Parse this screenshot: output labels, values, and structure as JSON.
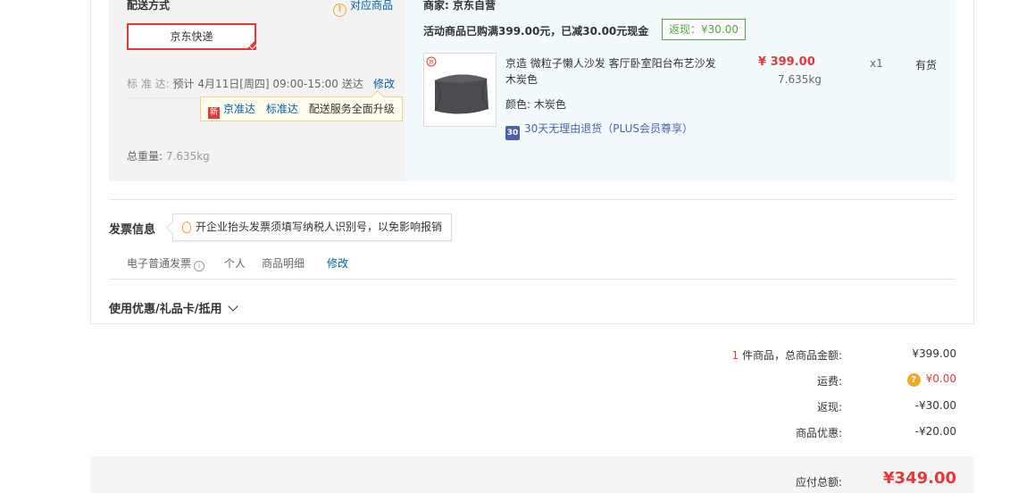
{
  "shipping": {
    "section_title": "配送方式",
    "matching_products_link": "对应商品",
    "method_label": "京东快递",
    "standard_label": "标  准  达:",
    "estimate_text": "预计 4月11日[周四] 09:00-15:00 送达",
    "modify_link": "修改",
    "tip_new_badge": "新",
    "tip_brand": "京准达",
    "tip_standard": "标准达",
    "tip_text": "配送服务全面升级",
    "total_weight_label": "总重量:",
    "total_weight_value": "7.635kg"
  },
  "goods": {
    "merchant_label": "商家:",
    "merchant_name": "京东自营",
    "promo_text": "活动商品已购满399.00元，已减30.00元现金",
    "rebate_tag": "返现：¥30.00",
    "product": {
      "name_line1": "京造 微粒子懒人沙发 客厅卧室阳台布艺沙发",
      "name_line2": "木炭色",
      "color_label": "颜色:",
      "color_value": "木炭色",
      "price": "¥ 399.00",
      "weight": "7.635kg",
      "quantity": "x1",
      "stock": "有货",
      "return_badge": "30",
      "return_text": "30天无理由退货（PLUS会员尊享）"
    }
  },
  "invoice": {
    "section_title": "发票信息",
    "tip_text": "开企业抬头发票须填写纳税人识别号，以免影响报销",
    "type": "电子普通发票",
    "info_icon": "i",
    "title_type": "个人",
    "content": "商品明细",
    "modify_link": "修改"
  },
  "coupon": {
    "section_title": "使用优惠/礼品卡/抵用"
  },
  "summary": {
    "item_count": "1",
    "item_label": "件商品，总商品金额:",
    "item_total": "¥399.00",
    "shipping_label": "运费:",
    "shipping_help_icon": "?",
    "shipping_fee": "¥0.00",
    "rebate_label": "返现:",
    "rebate_value": "-¥30.00",
    "discount_label": "商品优惠:",
    "discount_value": "-¥20.00",
    "payable_label": "应付总额:",
    "payable_value": "¥349.00"
  },
  "colors": {
    "accent_red": "#e4393c",
    "link_blue": "#005ea7",
    "green": "#52a347",
    "orange": "#f0a626"
  }
}
